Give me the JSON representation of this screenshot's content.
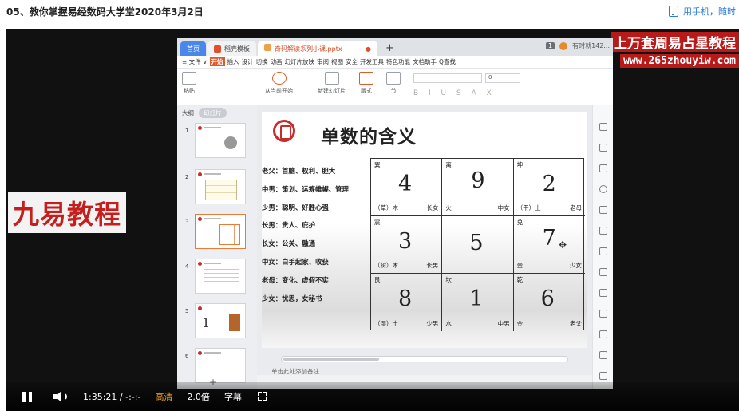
{
  "page": {
    "title": "05、教你掌握易经数码大学堂2020年3月2日",
    "phone_link": "用手机，随时"
  },
  "watermarks": {
    "left": "九易教程",
    "right_line1": "上万套周易占星教程",
    "right_line2": "www.265zhouyiw.com"
  },
  "wps": {
    "tabs": [
      {
        "label": "首页"
      },
      {
        "label": "稻壳模板"
      },
      {
        "label": "奇码解读系列小课.pptx"
      }
    ],
    "right_info": "有时就142...",
    "menu": [
      "≡ 文件 ∨",
      "开始",
      "插入",
      "设计",
      "切换",
      "动画",
      "幻灯片放映",
      "审阅",
      "视图",
      "安全",
      "开发工具",
      "特色功能",
      "文档助手",
      "Q查找"
    ],
    "menu_active": "开始",
    "tools": [
      "粘贴",
      "从当前开始",
      "新建幻灯片",
      "版式",
      "节"
    ],
    "font_size": "0",
    "sidebar_tabs": [
      "大纲",
      "幻灯片"
    ],
    "thumb_numbers": [
      "1",
      "2",
      "3",
      "4",
      "5",
      "6"
    ],
    "notes_placeholder": "单击此处添加备注"
  },
  "slide": {
    "title": "单数的含义",
    "roles": [
      "老父：首脑、权利、胆大",
      "中男：策划、运筹帷幄、管理",
      "少男：聪明、好胜心强",
      "长男：贵人、庇护",
      "长女：公关、融通",
      "中女：白手起家、收获",
      "老母：变化、虚假不实",
      "少女：忧思，女秘书"
    ],
    "grid": [
      {
        "trigram": "巽",
        "number": "4",
        "element": "（草）木",
        "family": "长女"
      },
      {
        "trigram": "离",
        "number": "9",
        "element": "火",
        "family": "中女"
      },
      {
        "trigram": "坤",
        "number": "2",
        "element": "（干）土",
        "family": "老母"
      },
      {
        "trigram": "震",
        "number": "3",
        "element": "（树）木",
        "family": "长男"
      },
      {
        "trigram": "",
        "number": "5",
        "element": "",
        "family": ""
      },
      {
        "trigram": "兑",
        "number": "7",
        "element": "金",
        "family": "少女"
      },
      {
        "trigram": "艮",
        "number": "8",
        "element": "（湿）土",
        "family": "少男"
      },
      {
        "trigram": "坎",
        "number": "1",
        "element": "水",
        "family": "中男"
      },
      {
        "trigram": "乾",
        "number": "6",
        "element": "金",
        "family": "老父"
      }
    ]
  },
  "player": {
    "time": "1:35:21 / -:-:-",
    "quality": "高清",
    "speed": "2.0倍",
    "subtitle": "字幕"
  }
}
